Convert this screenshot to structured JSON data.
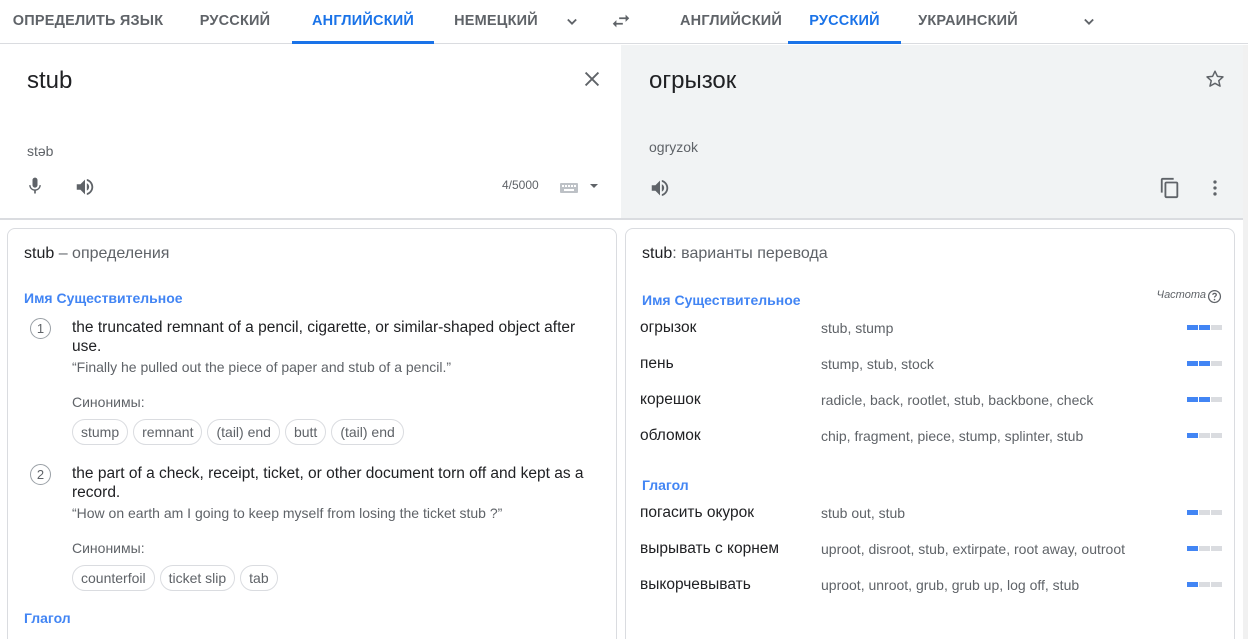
{
  "source_langs": [
    "ОПРЕДЕЛИТЬ ЯЗЫК",
    "РУССКИЙ",
    "АНГЛИЙСКИЙ",
    "НЕМЕЦКИЙ"
  ],
  "target_langs": [
    "АНГЛИЙСКИЙ",
    "РУССКИЙ",
    "УКРАИНСКИЙ"
  ],
  "source": {
    "text": "stub",
    "transcription": "stəb",
    "char_count": "4/5000"
  },
  "target": {
    "text": "огрызок",
    "transliteration": "ogryzok"
  },
  "definitions": {
    "title_word": "stub",
    "title_rest": " – определения",
    "noun_label": "Имя Существительное",
    "verb_label": "Глагол",
    "synonyms_label": "Синонимы:",
    "items": [
      {
        "num": "1",
        "text": "the truncated remnant of a pencil, cigarette, or similar-shaped object after use.",
        "example": "“Finally he pulled out the piece of paper and stub of a pencil.”",
        "synonyms": [
          "stump",
          "remnant",
          "(tail) end",
          "butt",
          "(tail) end"
        ]
      },
      {
        "num": "2",
        "text": "the part of a check, receipt, ticket, or other document torn off and kept as a record.",
        "example": "“How on earth am I going to keep myself from losing the ticket stub ?”",
        "synonyms": [
          "counterfoil",
          "ticket slip",
          "tab"
        ]
      }
    ]
  },
  "translations": {
    "title_word": "stub",
    "title_rest": ": варианты перевода",
    "frequency_label": "Частота",
    "groups": [
      {
        "label": "Имя Существительное",
        "rows": [
          {
            "word": "огрызок",
            "synonyms": "stub, stump",
            "frequency": 2
          },
          {
            "word": "пень",
            "synonyms": "stump, stub, stock",
            "frequency": 2
          },
          {
            "word": "корешок",
            "synonyms": "radicle, back, rootlet, stub, backbone, check",
            "frequency": 2
          },
          {
            "word": "обломок",
            "synonyms": "chip, fragment, piece, stump, splinter, stub",
            "frequency": 1
          }
        ]
      },
      {
        "label": "Глагол",
        "rows": [
          {
            "word": "погасить окурок",
            "synonyms": "stub out, stub",
            "frequency": 1
          },
          {
            "word": "вырывать с корнем",
            "synonyms": "uproot, disroot, stub, extirpate, root away, outroot",
            "frequency": 1
          },
          {
            "word": "выкорчевывать",
            "synonyms": "uproot, unroot, grub, grub up, log off, stub",
            "frequency": 1
          }
        ]
      }
    ]
  },
  "colors": {
    "accent": "#1a73e8",
    "pos_label": "#4285f4",
    "freq_on": "#4285f4",
    "freq_off": "#dadce0"
  },
  "icons": [
    "chevron-down-icon",
    "swap-languages-icon",
    "clear-icon",
    "microphone-icon",
    "speaker-icon",
    "keyboard-icon",
    "star-icon",
    "copy-icon",
    "more-vert-icon",
    "help-icon"
  ]
}
